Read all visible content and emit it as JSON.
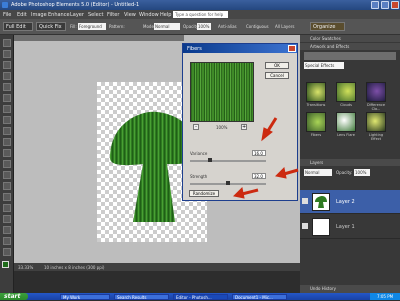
{
  "window": {
    "title": "Adobe Photoshop Elements 5.0 (Editor) - Untitled-1"
  },
  "menu": {
    "items": [
      "File",
      "Edit",
      "Image",
      "Enhance",
      "Layer",
      "Select",
      "Filter",
      "View",
      "Window",
      "Help"
    ],
    "help_search_placeholder": "Type a question for help"
  },
  "options_bar": {
    "mode_full_edit": "Full Edit",
    "mode_quick_fix": "Quick Fix",
    "organize": "Organize",
    "fill_label": "Fill:",
    "fill_value": "Foreground",
    "pattern_label": "Pattern:",
    "mode_label": "Mode:",
    "mode_value": "Normal",
    "opacity_label": "Opacity:",
    "opacity_value": "100%",
    "antialias": "Anti-alias",
    "contiguous": "Contiguous",
    "all_layers": "All Layers"
  },
  "status_bar": {
    "zoom": "33.33%",
    "doc_size": "10 inches x 8 inches (300 ppi)"
  },
  "fibers_dialog": {
    "title": "Fibers",
    "ok": "OK",
    "cancel": "Cancel",
    "zoom": "100%",
    "zoom_out": "-",
    "zoom_in": "+",
    "variance_label": "Variance",
    "variance_value": "16.0",
    "variance_fraction": 0.25,
    "strength_label": "Strength",
    "strength_value": "32.0",
    "strength_fraction": 0.5,
    "randomize": "Randomize"
  },
  "right_panel": {
    "color_swatches": "Color Swatches",
    "artwork_effects": "Artwork and Effects",
    "special_effects": "Special Effects",
    "effects": [
      "Transitions",
      "Clouds",
      "Difference Clo...",
      "Fibers",
      "Lens Flare",
      "Lighting Effect"
    ],
    "layers": "Layers",
    "layer_mode": "Normal",
    "layer_opacity_label": "Opacity:",
    "layer_opacity": "100%",
    "layers_list": [
      "Layer 2",
      "Layer 1"
    ],
    "undo_history": "Undo History"
  },
  "taskbar": {
    "start": "start",
    "tasks": [
      "My Work",
      "Search Results",
      "Editor - Photosh...",
      "Document1 - Mic..."
    ],
    "clock": "7:05 PM"
  },
  "colors": {
    "accent": "#3c5fa8",
    "fibers_green": "#3f8a28",
    "arrow": "#cc2a10"
  }
}
